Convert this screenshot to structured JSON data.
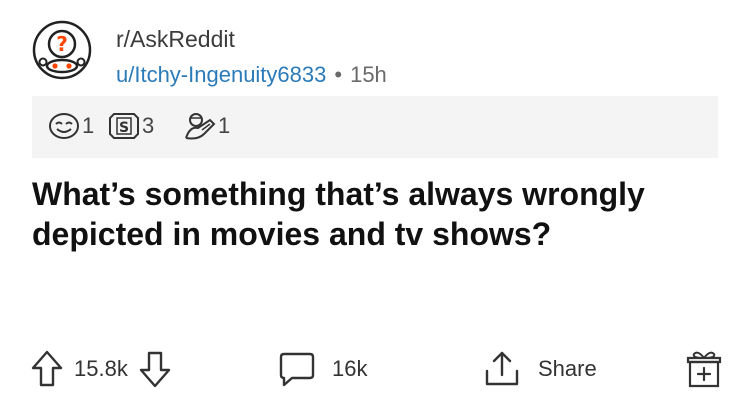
{
  "post": {
    "subreddit": "r/AskReddit",
    "author": "u/Itchy-Ingenuity6833",
    "separator": "•",
    "age": "15h",
    "title": "What’s something that’s always wrongly depicted in movies and tv shows?",
    "awards": [
      {
        "icon": "wholesome-award-icon",
        "count": "1"
      },
      {
        "icon": "silver-award-icon",
        "count": "3"
      },
      {
        "icon": "hugz-award-icon",
        "count": "1"
      }
    ],
    "score": "15.8k",
    "comments": "16k",
    "share_label": "Share"
  },
  "colors": {
    "link": "#2b7bb9",
    "award_bar": "#f4f4f5",
    "icon_stroke": "#333333"
  }
}
